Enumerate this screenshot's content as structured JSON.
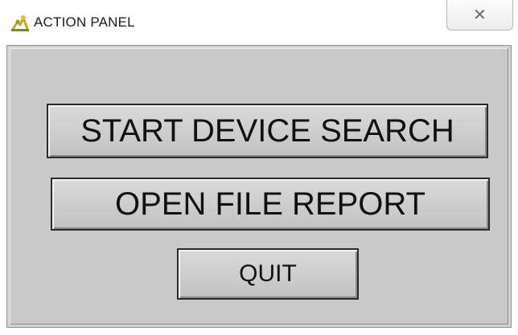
{
  "window": {
    "title": "ACTION PANEL",
    "icon": "app-icon",
    "close_glyph": "✕"
  },
  "panel": {
    "buttons": [
      {
        "label": "START DEVICE SEARCH"
      },
      {
        "label": "OPEN FILE REPORT"
      },
      {
        "label": "QUIT"
      }
    ]
  }
}
